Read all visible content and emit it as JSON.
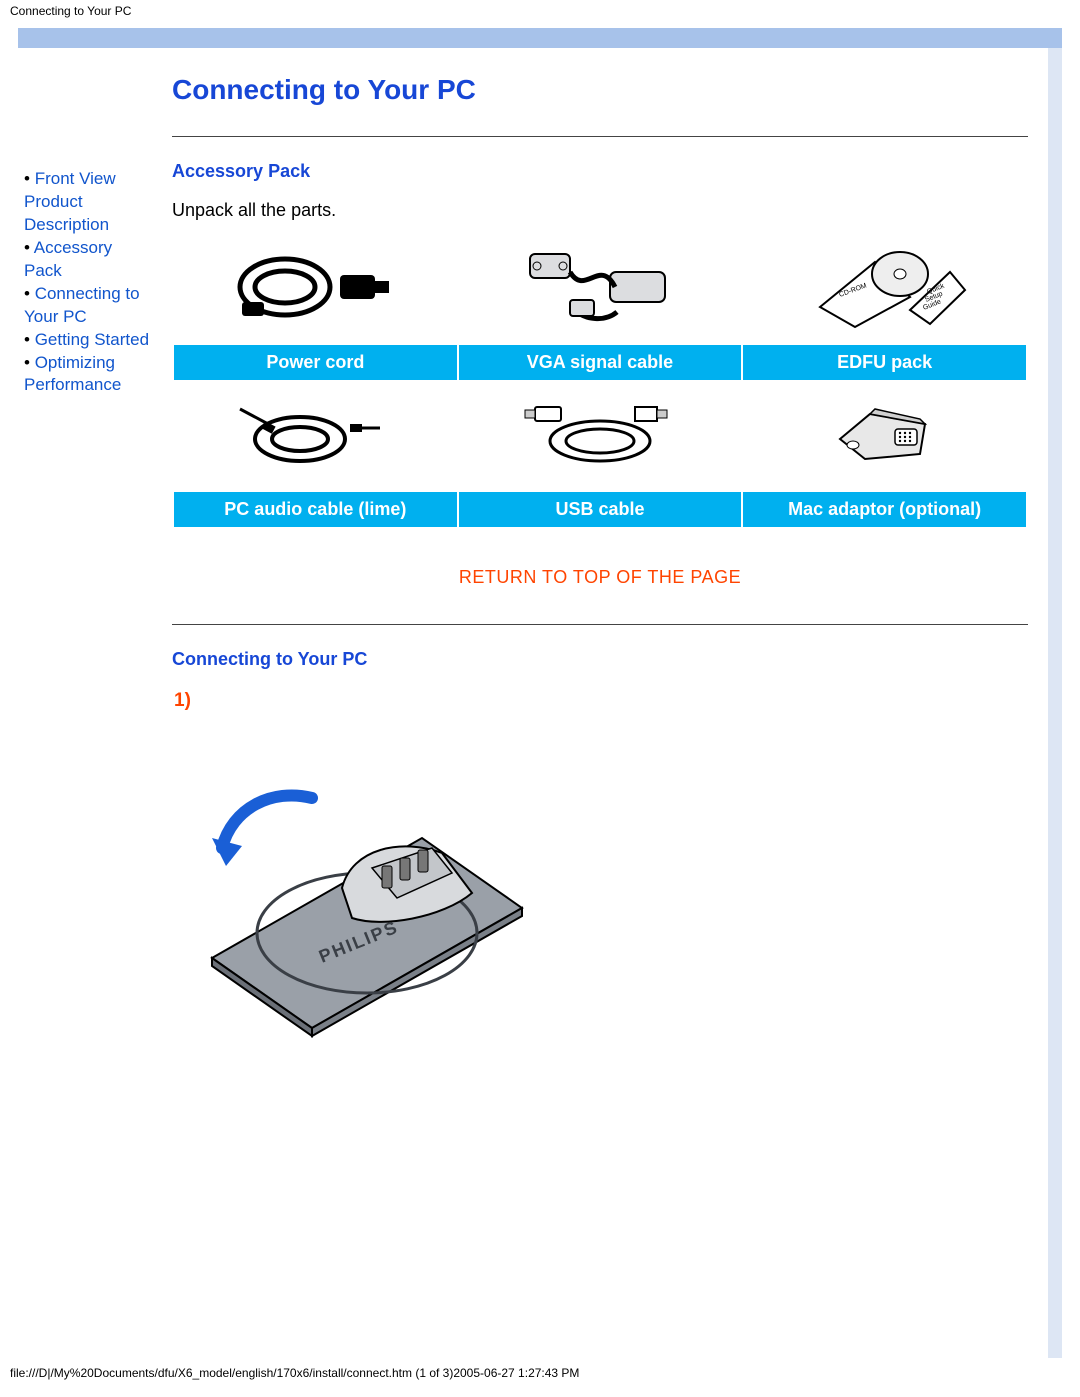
{
  "header": {
    "title": "Connecting to Your PC"
  },
  "sidebar": {
    "items": [
      {
        "label": "Front View Product Description"
      },
      {
        "label": "Accessory Pack"
      },
      {
        "label": "Connecting to Your PC"
      },
      {
        "label": "Getting Started"
      },
      {
        "label": "Optimizing Performance"
      }
    ]
  },
  "main": {
    "title": "Connecting to Your PC",
    "accessory": {
      "heading": "Accessory Pack",
      "instruction": "Unpack all the parts.",
      "row1": [
        {
          "label": "Power cord"
        },
        {
          "label": "VGA signal cable"
        },
        {
          "label": "EDFU pack"
        }
      ],
      "row2": [
        {
          "label": "PC audio cable (lime)"
        },
        {
          "label": "USB cable"
        },
        {
          "label": "Mac adaptor (optional)"
        }
      ]
    },
    "return_link": "RETURN TO TOP OF THE PAGE",
    "connecting": {
      "heading": "Connecting to Your PC",
      "step1_number": "1)"
    }
  },
  "footer": {
    "path": "file:///D|/My%20Documents/dfu/X6_model/english/170x6/install/connect.htm (1 of 3)2005-06-27 1:27:43 PM"
  }
}
